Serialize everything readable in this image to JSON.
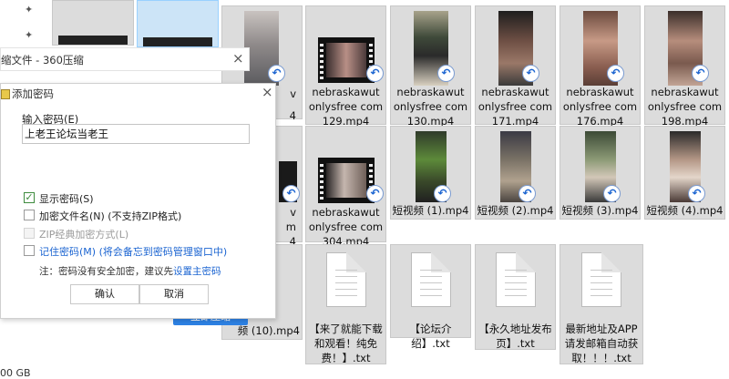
{
  "status_bar": {
    "text": "00 GB"
  },
  "files": [
    {
      "id": "f1",
      "lines": [
        "nebraskawut",
        "onlysfree com",
        "129.mp4"
      ]
    },
    {
      "id": "f2",
      "lines": [
        "nebraskawut",
        "onlysfree com",
        "130.mp4"
      ]
    },
    {
      "id": "f3",
      "lines": [
        "nebraskawut",
        "onlysfree com",
        "171.mp4"
      ]
    },
    {
      "id": "f4",
      "lines": [
        "nebraskawut",
        "onlysfree com",
        "176.mp4"
      ]
    },
    {
      "id": "f5",
      "lines": [
        "nebraskawut",
        "onlysfree com",
        "198.mp4"
      ]
    },
    {
      "id": "f6",
      "lines": [
        "nebraskawut",
        "onlysfree com",
        "304.mp4"
      ]
    },
    {
      "id": "f7",
      "lines": [
        "短视频 (1).mp4"
      ]
    },
    {
      "id": "f8",
      "lines": [
        "短视频 (2).mp4"
      ]
    },
    {
      "id": "f9",
      "lines": [
        "短视频 (3).mp4"
      ]
    },
    {
      "id": "f10",
      "lines": [
        "短视频 (4).mp4"
      ]
    },
    {
      "id": "f11",
      "lines": [
        "【来了就能下载",
        "和观看！纯免",
        "费！】.txt"
      ]
    },
    {
      "id": "f12",
      "lines": [
        "【论坛介绍】.txt"
      ]
    },
    {
      "id": "f13",
      "lines": [
        "【永久地址发布",
        "页】.txt"
      ]
    },
    {
      "id": "f14",
      "lines": [
        "最新地址及APP",
        "请发邮箱自动获",
        "取！！！.txt"
      ]
    }
  ],
  "partial_labels": {
    "row1_p1": "v",
    "row1_p2": "4",
    "row2_p1": "v",
    "row2_p2": "m",
    "row2_p3": "4",
    "row3": "频 (10).mp4"
  },
  "background_window": {
    "title": "缩文件 - 360压缩",
    "close": "×"
  },
  "dialog": {
    "title": "添加密码",
    "close": "×",
    "password_label": "输入密码(E)",
    "password_value": "上老王论坛当老王",
    "options": {
      "show_password": "显示密码(S)",
      "encrypt_filenames": "加密文件名(N) (不支持ZIP格式)",
      "zip_classic": "ZIP经典加密方式(L)",
      "remember_password": "记住密码(M) (将会备忘到密码管理窗口中)"
    },
    "note_prefix": "注：密码没有安全加密，建议先",
    "note_link": "设置主密码",
    "ok_label": "确认",
    "cancel_label": "取消"
  },
  "bg_button": {
    "label": "立即压缩"
  },
  "colors": {
    "accent_blue": "#2d82e6",
    "link_blue": "#1b64d1",
    "check_green": "#3d8b3d",
    "tile_gray": "#dcdcdc",
    "tile_selected": "#cce4f7"
  }
}
